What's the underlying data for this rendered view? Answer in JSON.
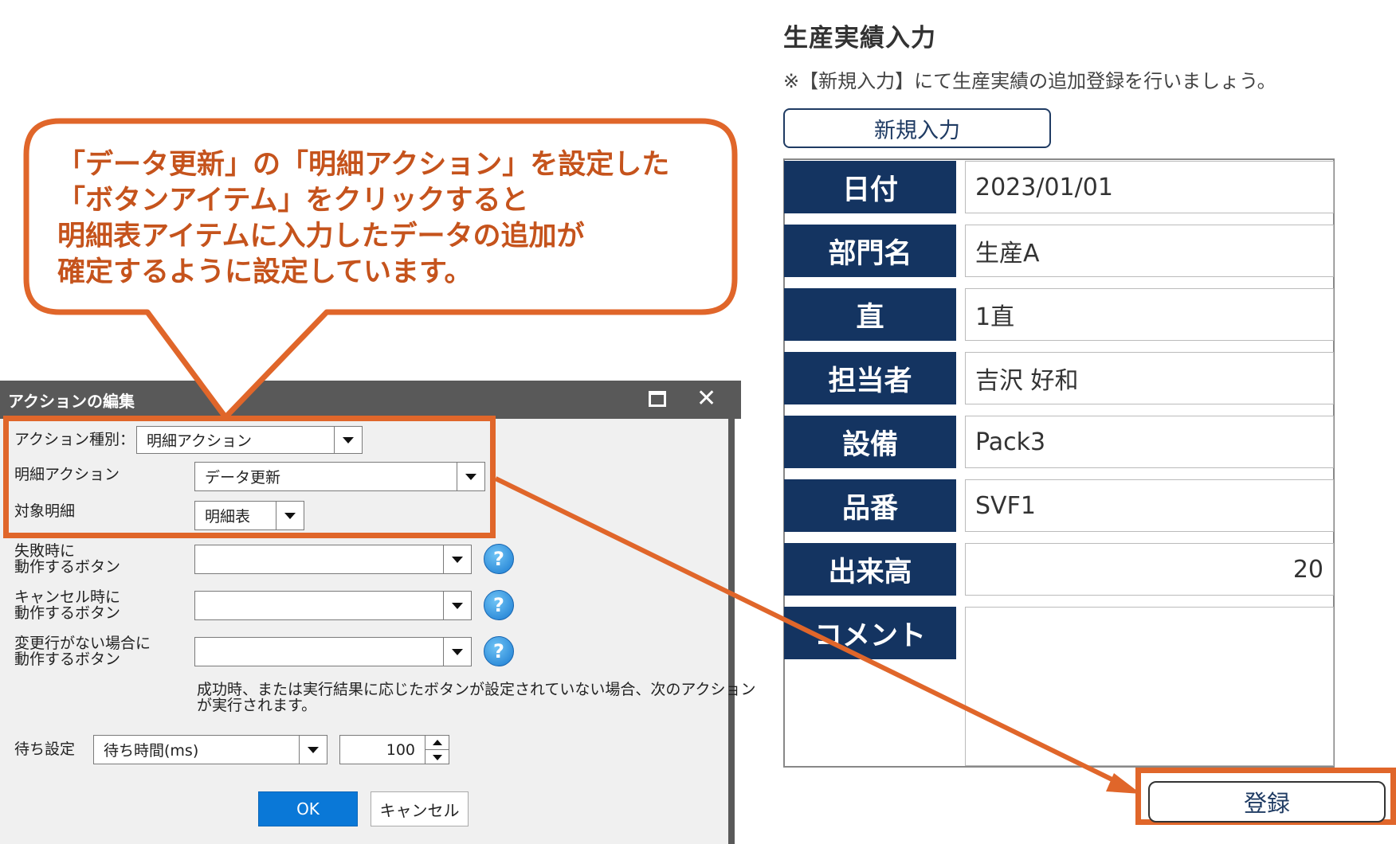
{
  "form": {
    "title": "生産実績入力",
    "note": "※【新規入力】にて生産実績の追加登録を行いましょう。",
    "new_button": "新規入力",
    "rows": [
      {
        "label": "日付",
        "value": "2023/01/01"
      },
      {
        "label": "部門名",
        "value": "生産A"
      },
      {
        "label": "直",
        "value": "1直"
      },
      {
        "label": "担当者",
        "value": "吉沢 好和"
      },
      {
        "label": "設備",
        "value": "Pack3"
      },
      {
        "label": "品番",
        "value": "SVF1"
      },
      {
        "label": "出来高",
        "value": "20"
      },
      {
        "label": "コメント",
        "value": ""
      }
    ],
    "submit_button": "登録"
  },
  "callout": {
    "lines": [
      "「データ更新」の「明細アクション」を設定した",
      "「ボタンアイテム」をクリックすると",
      "明細表アイテムに入力したデータの追加が",
      "確定するように設定しています。"
    ]
  },
  "dialog": {
    "title": "アクションの編集",
    "action_type_label": "アクション種別：",
    "action_type_value": "明細アクション",
    "detail_action_label": "明細アクション",
    "detail_action_value": "データ更新",
    "target_detail_label": "対象明細",
    "target_detail_value": "明細表",
    "on_fail_label_1": "失敗時に",
    "on_fail_label_2": "動作するボタン",
    "on_cancel_label_1": "キャンセル時に",
    "on_cancel_label_2": "動作するボタン",
    "no_change_label_1": "変更行がない場合に",
    "no_change_label_2": "動作するボタン",
    "note_1": "成功時、または実行結果に応じたボタンが設定されていない場合、次のアクション",
    "note_2": "が実行されます。",
    "wait_label": "待ち設定",
    "wait_value": "待ち時間(ms)",
    "wait_ms": "100",
    "ok": "OK",
    "cancel": "キャンセル",
    "help_glyph": "?"
  },
  "colors": {
    "accent_orange": "#e0662a",
    "label_navy": "#143461",
    "dialog_title": "#595959",
    "ok_blue": "#0a78d7"
  }
}
